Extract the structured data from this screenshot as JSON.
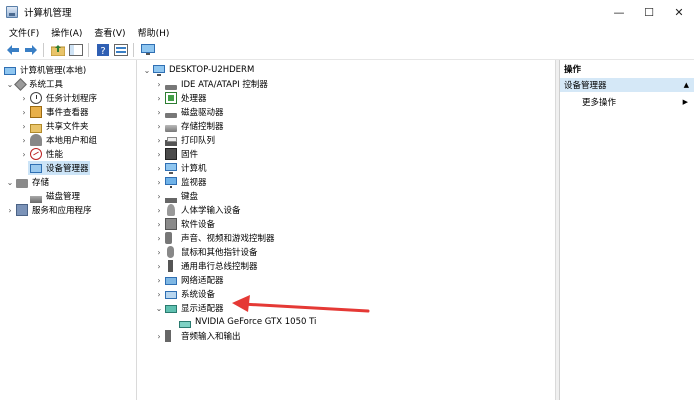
{
  "window": {
    "title": "计算机管理"
  },
  "menu": [
    "文件(F)",
    "操作(A)",
    "查看(V)",
    "帮助(H)"
  ],
  "toolbar_icons": [
    "back-arrow-icon",
    "forward-arrow-icon",
    "up-folder-icon",
    "show-hide-tree-icon",
    "help-icon",
    "properties-icon",
    "monitor-icon"
  ],
  "left_tree": {
    "root": "计算机管理(本地)",
    "system_tools": "系统工具",
    "task_scheduler": "任务计划程序",
    "event_viewer": "事件查看器",
    "shared_folders": "共享文件夹",
    "local_users": "本地用户和组",
    "performance": "性能",
    "device_manager": "设备管理器",
    "storage": "存储",
    "disk_management": "磁盘管理",
    "services_apps": "服务和应用程序"
  },
  "device_tree": {
    "root": "DESKTOP-U2HDERM",
    "categories": [
      "IDE ATA/ATAPI 控制器",
      "处理器",
      "磁盘驱动器",
      "存储控制器",
      "打印队列",
      "固件",
      "计算机",
      "监视器",
      "键盘",
      "人体学输入设备",
      "软件设备",
      "声音、视频和游戏控制器",
      "鼠标和其他指针设备",
      "通用串行总线控制器",
      "网络适配器",
      "系统设备",
      "显示适配器"
    ],
    "gpu": "NVIDIA GeForce GTX 1050 Ti",
    "audio": "音频输入和输出"
  },
  "actions": {
    "header": "操作",
    "section": "设备管理器",
    "more": "更多操作"
  },
  "colors": {
    "selection": "#cce4f7",
    "action_section": "#d5e8f7",
    "arrow": "#e53935"
  }
}
